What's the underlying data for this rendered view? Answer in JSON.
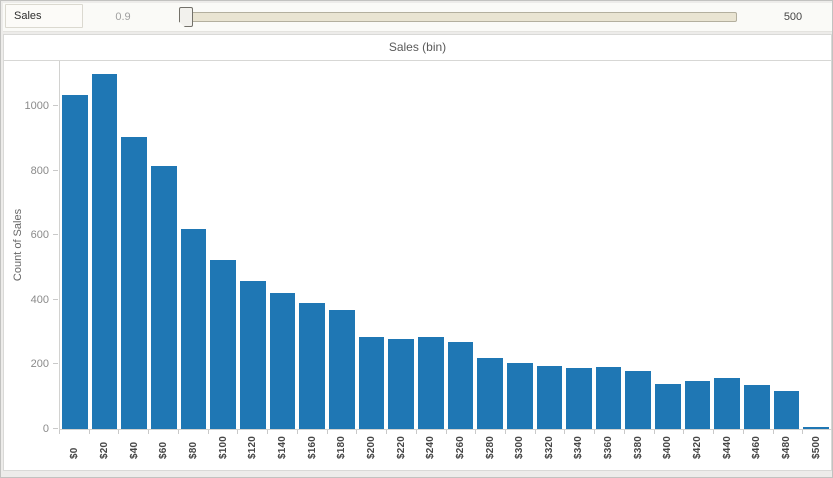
{
  "filter_bar": {
    "field_label": "Sales",
    "min_value": "0.9",
    "max_value": "500"
  },
  "chart_data": {
    "type": "bar",
    "title": "Sales (bin)",
    "xlabel": "Sales (bin)",
    "ylabel": "Count of Sales",
    "categories": [
      "$0",
      "$20",
      "$40",
      "$60",
      "$80",
      "$100",
      "$120",
      "$140",
      "$160",
      "$180",
      "$200",
      "$220",
      "$240",
      "$260",
      "$280",
      "$300",
      "$320",
      "$340",
      "$360",
      "$380",
      "$400",
      "$420",
      "$440",
      "$460",
      "$480",
      "$500"
    ],
    "values": [
      1035,
      1100,
      905,
      815,
      620,
      525,
      460,
      420,
      390,
      370,
      285,
      280,
      285,
      270,
      220,
      205,
      195,
      190,
      193,
      180,
      140,
      150,
      157,
      136,
      117,
      4
    ],
    "bin_width": 20,
    "y_ticks": [
      0,
      200,
      400,
      600,
      800,
      1000
    ],
    "ylim": [
      0,
      1140
    ],
    "grid": false,
    "legend": false,
    "bar_color": "#1f77b4",
    "axis_color": "#d2d2d0",
    "tick_color": "#c9c9c9"
  }
}
